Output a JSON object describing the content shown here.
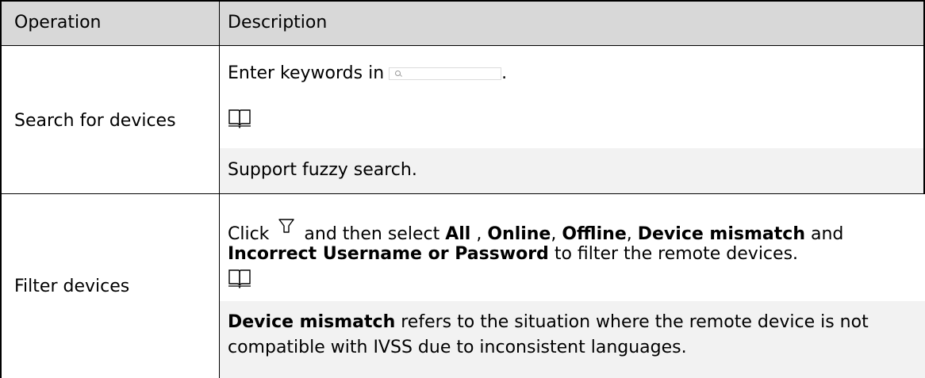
{
  "header": {
    "col1": "Operation",
    "col2": "Description"
  },
  "rows": [
    {
      "operation": "Search for devices",
      "line1_prefix": "Enter keywords in",
      "line1_suffix": ".",
      "search_icon": "search-input-icon",
      "note_icon": "book-icon",
      "note": "Support fuzzy search."
    },
    {
      "operation": "Filter devices",
      "click": "Click",
      "filter_icon": "filter-icon",
      "and_then_select": "and then select",
      "opt_all": "All",
      "sep1": " ,",
      "opt_online": "Online",
      "sep2": ",",
      "opt_offline": "Offline",
      "sep3": ",",
      "opt_mismatch": "Device mismatch",
      "and": "and",
      "opt_incorrect": "Incorrect Username or Password",
      "tail": "to filter the remote devices.",
      "note_icon": "book-icon",
      "note_bold": "Device mismatch",
      "note_line1": "refers to the situation where the remote device is not",
      "note_line2": "compatible with IVSS due to inconsistent languages."
    }
  ]
}
